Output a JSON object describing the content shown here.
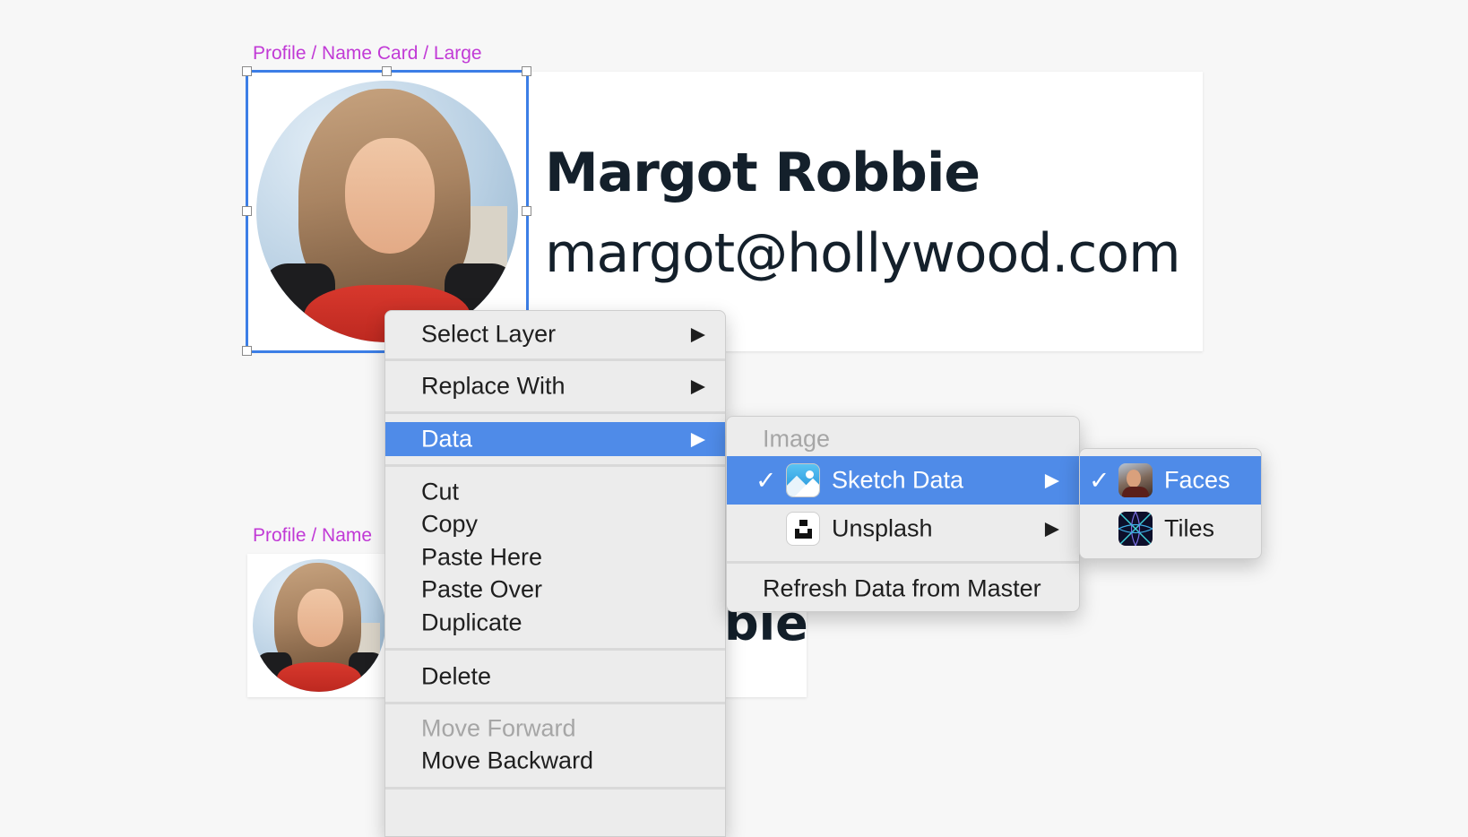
{
  "canvas": {
    "label_large": "Profile / Name Card / Large",
    "label_small": "Profile / Name",
    "large_card": {
      "name": "Margot Robbie",
      "email": "margot@hollywood.com"
    },
    "small_card": {
      "name_visible_fragment": "bie"
    }
  },
  "context_menu": {
    "items": [
      {
        "label": "Select Layer",
        "arrow": "▶"
      },
      {
        "label": "Replace With",
        "arrow": "▶"
      },
      {
        "label": "Data",
        "arrow": "▶"
      },
      {
        "label": "Cut"
      },
      {
        "label": "Copy"
      },
      {
        "label": "Paste Here"
      },
      {
        "label": "Paste Over"
      },
      {
        "label": "Duplicate"
      },
      {
        "label": "Delete"
      },
      {
        "label": "Move Forward"
      },
      {
        "label": "Move Backward"
      }
    ]
  },
  "data_submenu": {
    "header": "Image",
    "sketch_data": {
      "label": "Sketch Data",
      "check": "✓",
      "arrow": "▶",
      "icon": "sketch-data-icon"
    },
    "unsplash": {
      "label": "Unsplash",
      "arrow": "▶",
      "icon": "unsplash-icon"
    },
    "refresh": "Refresh Data from Master"
  },
  "sketch_data_submenu": {
    "faces": {
      "label": "Faces",
      "check": "✓",
      "icon": "faces-icon"
    },
    "tiles": {
      "label": "Tiles",
      "icon": "tiles-icon"
    }
  },
  "colors": {
    "highlight": "#4f8be8",
    "artboard_label": "#c13ad6",
    "selection": "#3c7ee6",
    "text_dark": "#14202b"
  }
}
